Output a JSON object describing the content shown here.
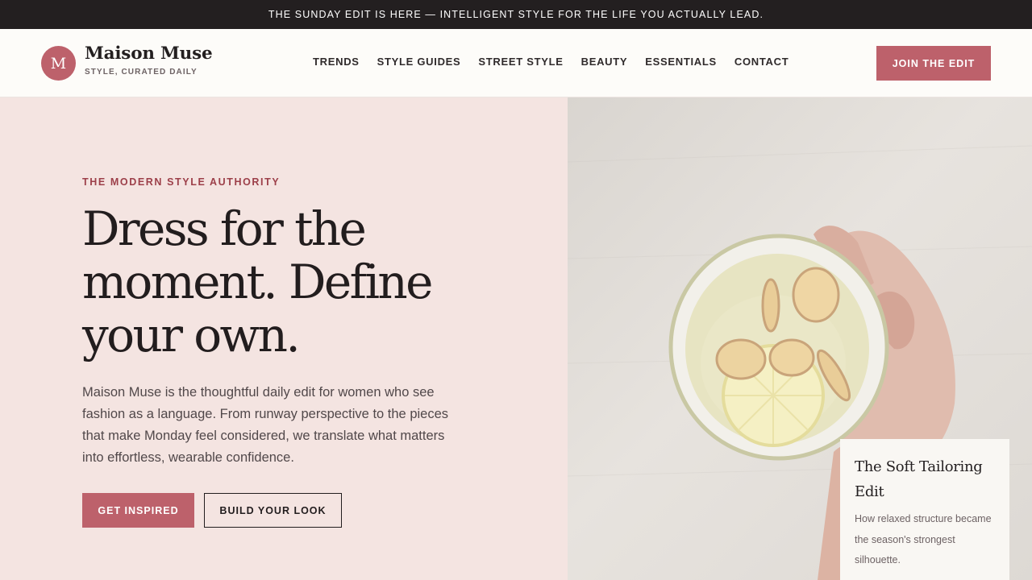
{
  "announcement": "THE SUNDAY EDIT IS HERE — INTELLIGENT STYLE FOR THE LIFE YOU ACTUALLY LEAD.",
  "brand": {
    "mark": "M",
    "name": "Maison Muse",
    "tagline": "STYLE, CURATED DAILY"
  },
  "nav": {
    "items": [
      "TRENDS",
      "STYLE GUIDES",
      "STREET STYLE",
      "BEAUTY",
      "ESSENTIALS",
      "CONTACT"
    ],
    "cta": "JOIN THE EDIT"
  },
  "hero": {
    "eyebrow": "THE MODERN STYLE AUTHORITY",
    "headline": "Dress for the moment. Define your own.",
    "lede": "Maison Muse is the thoughtful daily edit for women who see fashion as a language. From runway perspective to the pieces that make Monday feel considered, we translate what matters into effortless, wearable confidence.",
    "primary_button": "GET INSPIRED",
    "secondary_button": "BUILD YOUR LOOK",
    "image_icon": "tea-cup-photo"
  },
  "feature_card": {
    "title": "The Soft Tailoring Edit",
    "text": "How relaxed structure became the season's strongest silhouette."
  },
  "colors": {
    "accent": "#bd616b",
    "eyebrow": "#9c3f49",
    "hero_bg": "#f4e4e1",
    "bar_bg": "#231f20"
  }
}
